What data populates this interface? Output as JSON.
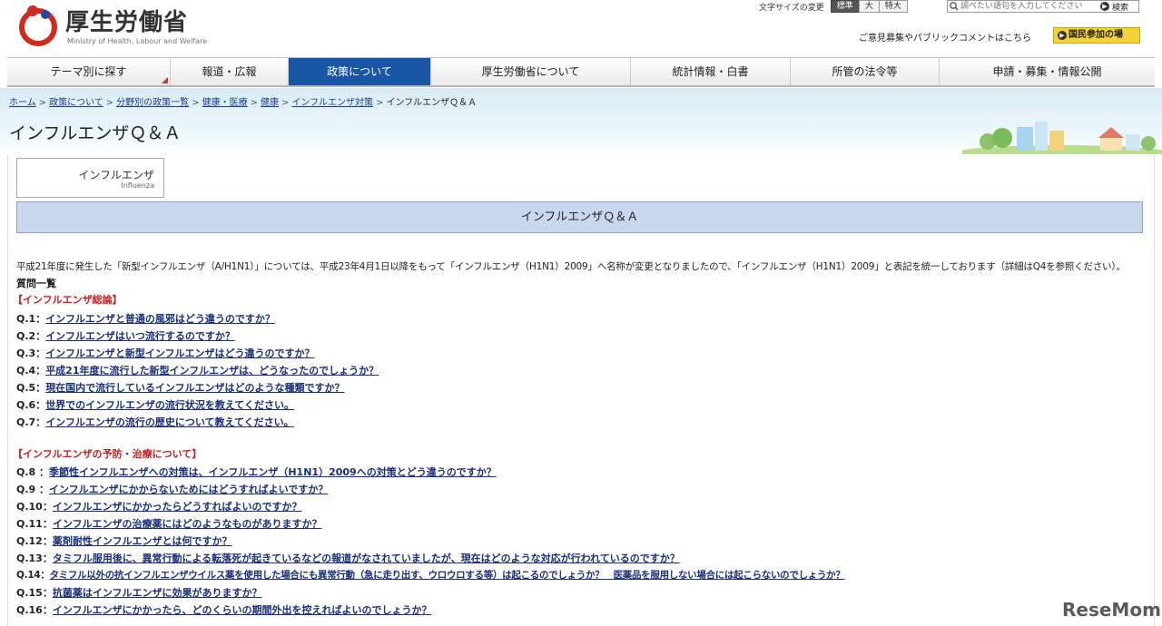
{
  "header": {
    "logo_title": "厚生労働省",
    "logo_sub": "Ministry of Health, Labour and Welfare",
    "fontsize_label": "文字サイズの変更",
    "fontsize_buttons": [
      "標準",
      "大",
      "特大"
    ],
    "search_placeholder": "調べたい語句を入力してください",
    "search_button": "検索",
    "public_comment": "ご意見募集やパブリックコメントはこちら",
    "kokumin_button": "国民参加の場"
  },
  "nav": {
    "items": [
      "テーマ別に探す",
      "報道・広報",
      "政策について",
      "厚生労働省について",
      "統計情報・白書",
      "所管の法令等",
      "申請・募集・情報公開"
    ],
    "active_index": 2
  },
  "breadcrumb": {
    "links": [
      "ホーム",
      "政策について",
      "分野別の政策一覧",
      "健康・医療",
      "健康",
      "インフルエンザ対策"
    ],
    "current": "インフルエンザＱ＆Ａ"
  },
  "page_title": "インフルエンザＱ＆Ａ",
  "flu_box": {
    "title": "インフルエンザ",
    "sub": "Influenza"
  },
  "heading_bar": "インフルエンザＱ＆Ａ",
  "intro": "平成21年度に発生した「新型インフルエンザ（A/H1N1）」については、平成23年4月1日以降をもって「インフルエンザ（H1N1）2009」へ名称が変更となりましたので、「インフルエンザ（H1N1）2009」と表記を統一しております（詳細はQ4を参照ください）。",
  "questions_heading": "質問一覧",
  "categories": [
    {
      "title": "【インフルエンザ総論】",
      "questions": [
        {
          "num": "Q.1：",
          "text": "インフルエンザと普通の風邪はどう違うのですか？"
        },
        {
          "num": "Q.2：",
          "text": "インフルエンザはいつ流行するのですか？"
        },
        {
          "num": "Q.3：",
          "text": "インフルエンザと新型インフルエンザはどう違うのですか？"
        },
        {
          "num": "Q.4：",
          "text": "平成21年度に流行した新型インフルエンザは、どうなったのでしょうか？"
        },
        {
          "num": "Q.5：",
          "text": "現在国内で流行しているインフルエンザはどのような種類ですか？"
        },
        {
          "num": "Q.6：",
          "text": "世界でのインフルエンザの流行状況を教えてください。"
        },
        {
          "num": "Q.7：",
          "text": "インフルエンザの流行の歴史について教えてください。"
        }
      ]
    },
    {
      "title": "【インフルエンザの予防・治療について】",
      "questions": [
        {
          "num": "Q.8 ：",
          "text": "季節性インフルエンザへの対策は、インフルエンザ（H1N1）2009への対策とどう違うのですか？"
        },
        {
          "num": "Q.9 ：",
          "text": "インフルエンザにかからないためにはどうすればよいですか？"
        },
        {
          "num": "Q.10：",
          "text": "インフルエンザにかかったらどうすればよいのですか？"
        },
        {
          "num": "Q.11：",
          "text": "インフルエンザの治療薬にはどのようなものがありますか？"
        },
        {
          "num": "Q.12：",
          "text": "薬剤耐性インフルエンザとは何ですか？"
        },
        {
          "num": "Q.13：",
          "text": "タミフル服用後に、異常行動による転落死が起きているなどの報道がなされていましたが、現在はどのような対応が行われているのですか？"
        },
        {
          "num": "Q.14：",
          "text": "タミフル以外の抗インフルエンザウイルス薬を使用した場合にも異常行動（急に走り出す、ウロウロする等）は起こるのでしょうか？　医薬品を服用しない場合には起こらないのでしょうか？"
        },
        {
          "num": "Q.15：",
          "text": "抗菌薬はインフルエンザに効果がありますか？"
        },
        {
          "num": "Q.16：",
          "text": "インフルエンザにかかったら、どのくらいの期間外出を控えればよいのでしょうか？"
        }
      ]
    }
  ],
  "watermark": "ReseMom",
  "colors": {
    "nav_active": "#1a56a6",
    "category_red": "#cc1f1f",
    "link": "#1a2f7a",
    "heading_bar": "#c9d8ee"
  }
}
